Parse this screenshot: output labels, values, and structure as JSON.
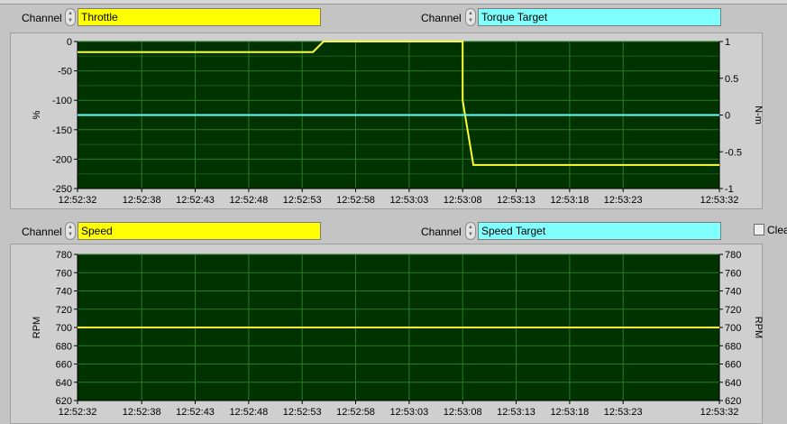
{
  "controls": {
    "channel_label": "Channel",
    "chart1_left": "Throttle",
    "chart1_right": "Torque Target",
    "chart2_left": "Speed",
    "chart2_right": "Speed Target",
    "clear_label": "Clea"
  },
  "colors": {
    "plot_bg": "#003300",
    "grid": "#2c7a2c",
    "primary_trace": "#ffff33",
    "secondary_trace": "#66ffff",
    "primary_field": "#ffff00",
    "secondary_field": "#80ffff"
  },
  "chart_data": [
    {
      "type": "line",
      "x_ticks": [
        "12:52:32",
        "12:52:38",
        "12:52:43",
        "12:52:48",
        "12:52:53",
        "12:52:58",
        "12:53:03",
        "12:53:08",
        "12:53:13",
        "12:53:18",
        "12:53:23",
        "12:53:32"
      ],
      "xlim": [
        "12:52:32",
        "12:53:32"
      ],
      "ylabel": "%",
      "ylim": [
        -250,
        0
      ],
      "y_ticks": [
        "0",
        "-50",
        "-100",
        "-150",
        "-200",
        "-250"
      ],
      "y2label": "N-m",
      "y2lim": [
        -1,
        1
      ],
      "y2_ticks": [
        "1",
        "0.5",
        "0",
        "-0.5",
        "-1"
      ],
      "grid": true,
      "series": [
        {
          "axis": "left",
          "points": [
            [
              "12:52:32",
              -18
            ],
            [
              "12:52:54",
              -18
            ],
            [
              "12:52:55",
              0
            ],
            [
              "12:53:08",
              0
            ],
            [
              "12:53:08",
              -100
            ],
            [
              "12:53:09",
              -210
            ],
            [
              "12:53:32",
              -210
            ]
          ]
        },
        {
          "axis": "right",
          "points": [
            [
              "12:52:32",
              0
            ],
            [
              "12:53:32",
              0
            ]
          ]
        }
      ]
    },
    {
      "type": "line",
      "x_ticks": [
        "12:52:32",
        "12:52:38",
        "12:52:43",
        "12:52:48",
        "12:52:53",
        "12:52:58",
        "12:53:03",
        "12:53:08",
        "12:53:13",
        "12:53:18",
        "12:53:23",
        "12:53:32"
      ],
      "xlim": [
        "12:52:32",
        "12:53:32"
      ],
      "ylabel": "RPM",
      "ylim": [
        620,
        780
      ],
      "y_ticks": [
        "780",
        "760",
        "740",
        "720",
        "700",
        "680",
        "660",
        "640",
        "620"
      ],
      "y2label": "RPM",
      "y2lim": [
        620,
        780
      ],
      "y2_ticks": [
        "780",
        "760",
        "740",
        "720",
        "700",
        "680",
        "660",
        "640",
        "620"
      ],
      "grid": true,
      "series": [
        {
          "axis": "left",
          "points": [
            [
              "12:52:32",
              700
            ],
            [
              "12:53:32",
              700
            ]
          ]
        },
        {
          "axis": "right",
          "points": [
            [
              "12:52:32",
              700
            ],
            [
              "12:53:32",
              700
            ]
          ]
        }
      ]
    }
  ]
}
